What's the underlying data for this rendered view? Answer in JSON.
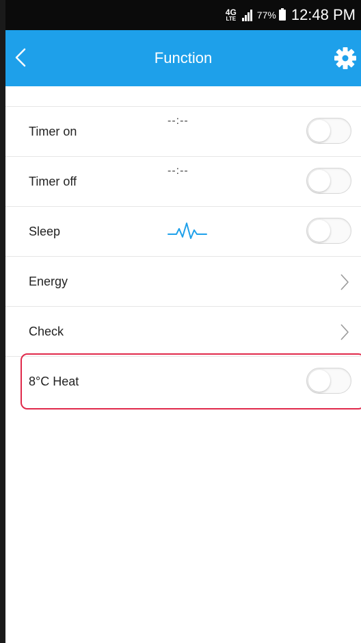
{
  "status_bar": {
    "network": "4G",
    "network_sub": "LTE",
    "battery_percent": "77%",
    "time": "12:48 PM"
  },
  "header": {
    "title": "Function",
    "back_icon": "chevron-left-icon",
    "settings_icon": "gear-icon"
  },
  "rows": [
    {
      "label": "Timer on",
      "value": "--:--",
      "control": "toggle",
      "on": false
    },
    {
      "label": "Timer off",
      "value": "--:--",
      "control": "toggle",
      "on": false
    },
    {
      "label": "Sleep",
      "icon": "sleep-wave-icon",
      "control": "toggle",
      "on": false
    },
    {
      "label": "Energy",
      "control": "chevron"
    },
    {
      "label": "Check",
      "control": "chevron"
    },
    {
      "label": "8°C Heat",
      "control": "toggle",
      "on": false,
      "highlighted": true
    }
  ],
  "colors": {
    "header_bg": "#1ea0ea",
    "accent_icon": "#1ea0ea",
    "highlight_border": "#e0294a"
  }
}
